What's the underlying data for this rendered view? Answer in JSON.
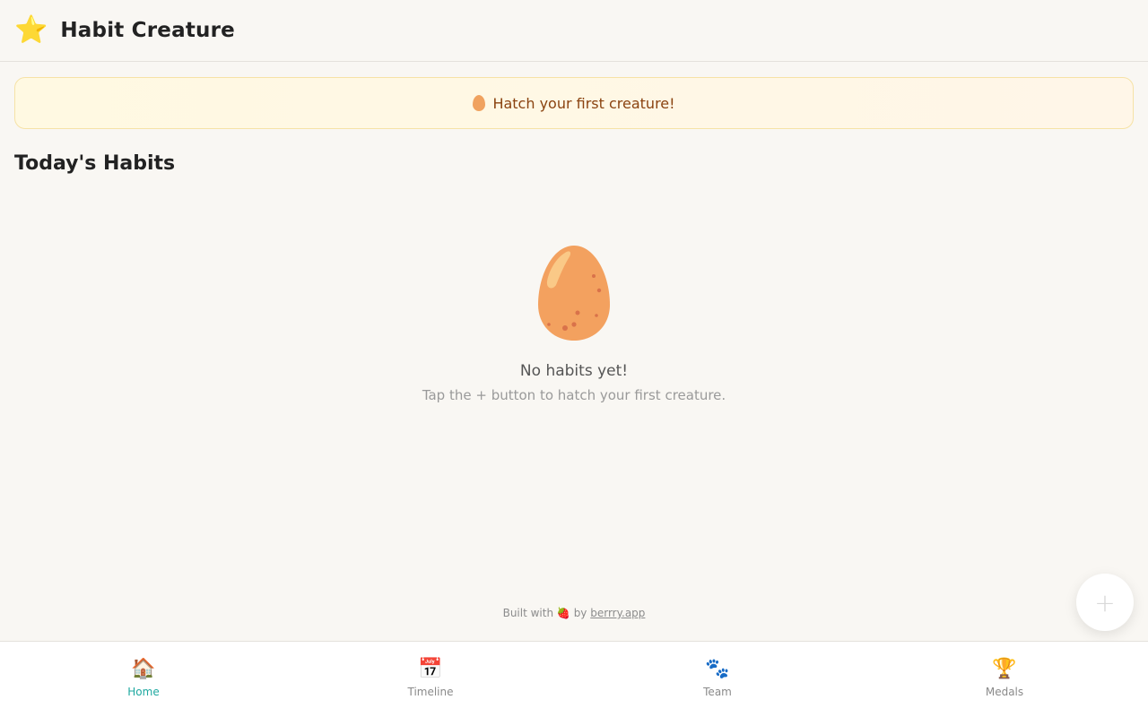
{
  "header": {
    "logo_icon": "star-icon",
    "logo_glyph": "⭐",
    "title": "Habit Creature"
  },
  "banner": {
    "icon": "egg-icon",
    "text": "Hatch your first creature!"
  },
  "section": {
    "title": "Today's Habits"
  },
  "empty_state": {
    "illustration": "egg-icon",
    "message": "No habits yet!",
    "hint": "Tap the + button to hatch your first creature."
  },
  "footer": {
    "prefix": "Built with",
    "berry_glyph": "🍓",
    "by": "by",
    "link": "berrry.app"
  },
  "fab": {
    "label": "+"
  },
  "tabs": [
    {
      "label": "Home",
      "icon": "house-icon",
      "glyph": "🏠",
      "active": true
    },
    {
      "label": "Timeline",
      "icon": "calendar-icon",
      "glyph": "📅",
      "active": false
    },
    {
      "label": "Team",
      "icon": "paw-icon",
      "glyph": "🐾",
      "active": false
    },
    {
      "label": "Medals",
      "icon": "trophy-icon",
      "glyph": "🏆",
      "active": false
    }
  ],
  "colors": {
    "background": "#f9f7f3",
    "accent": "#1ea8a0",
    "banner_text": "#8a4310",
    "egg": "#f0a25f"
  }
}
